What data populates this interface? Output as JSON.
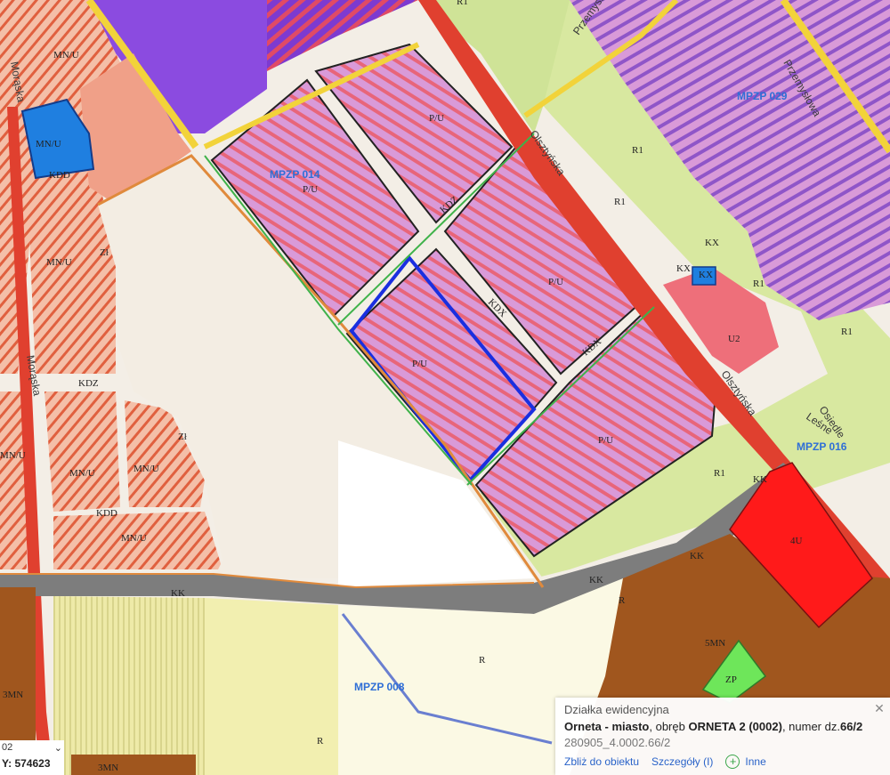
{
  "map": {
    "plan_labels": [
      "MPZP 014",
      "MPZP 029",
      "MPZP 016",
      "MPZP 008"
    ],
    "street_labels": [
      "Morąska",
      "Morąska",
      "Olsztyńska",
      "Olsztyńska",
      "Przemysłowa",
      "Przemysłowa",
      "Leśne",
      "Osiedle"
    ],
    "zone_labels": [
      "MN/U",
      "MN/U",
      "MN/U",
      "MN/U",
      "MN/U",
      "MN/U",
      "MN/U",
      "P/U",
      "P/U",
      "P/U",
      "P/U",
      "P/U",
      "R1",
      "R1",
      "R1",
      "R1",
      "R1",
      "R1",
      "U2",
      "KK",
      "KK",
      "KK",
      "KK",
      "KDZ",
      "KDZ",
      "KDX",
      "KDX",
      "KDD",
      "KDD",
      "R",
      "R",
      "R",
      "3MN",
      "3MN",
      "5MN",
      "ZP",
      "4U",
      "Zł",
      "Zł",
      "KX",
      "KX",
      "KX"
    ],
    "colors": {
      "pu_zone": "#d99ad8",
      "mnu_zone": "#f2b3a0",
      "r1_zone": "#d8e8a0",
      "service_zone": "#ff1a1a",
      "residential_zone": "#a0561e",
      "green_zone": "#6ee65a",
      "industrial_purple": "#8b4be0",
      "road_gray": "#7d7d7d",
      "road_red": "#e0402f",
      "selection_blue": "#1a2fe0",
      "boundary_orange": "#e08a3c",
      "agri_yellow": "#f2efb0"
    }
  },
  "popup": {
    "title": "Działka ewidencyjna",
    "place": "Orneta - miasto",
    "sep1": ", obręb ",
    "precinct": "ORNETA 2 (0002)",
    "sep2": ", numer dz.",
    "parcel": "66/2",
    "parcel_id": "280905_4.0002.66/2",
    "link_zoom": "Zbliż do obiektu",
    "link_details": "Szczegóły (I)",
    "link_more": "Inne",
    "close_icon": "close-icon",
    "add_icon": "plus-circle-icon"
  },
  "coords": {
    "selector_value": "02",
    "y_label": "Y: 574623"
  }
}
